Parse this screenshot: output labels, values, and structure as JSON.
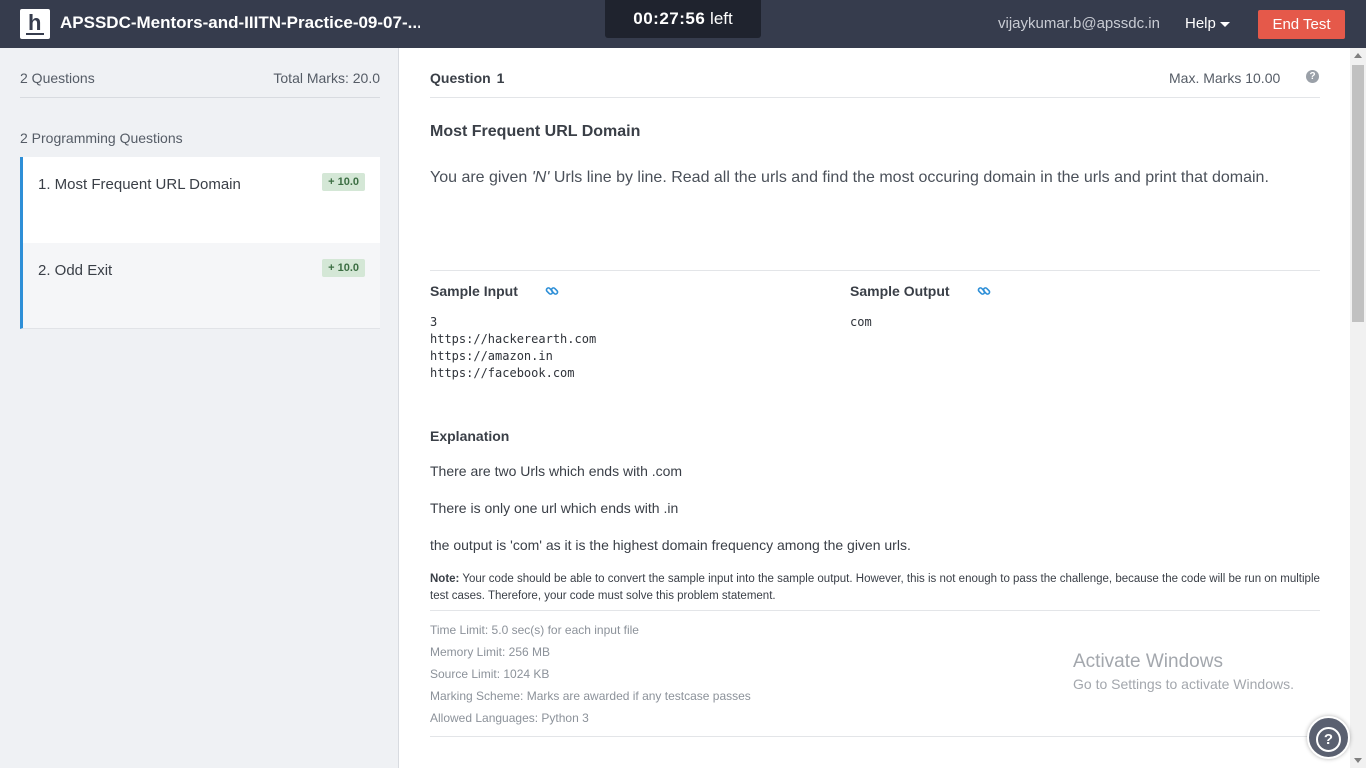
{
  "header": {
    "logo_letter": "h",
    "title": "APSSDC-Mentors-and-IIITN-Practice-09-07-...",
    "timer_value": "00:27:56",
    "timer_suffix": "left",
    "user_email": "vijaykumar.b@apssdc.in",
    "help_label": "Help",
    "end_test_label": "End Test"
  },
  "sidebar": {
    "question_count": "2 Questions",
    "total_marks": "Total Marks: 20.0",
    "section_label": "2 Programming Questions",
    "questions": [
      {
        "label": "1. Most Frequent URL Domain",
        "badge": "+ 10.0"
      },
      {
        "label": "2. Odd Exit",
        "badge": "+ 10.0"
      }
    ]
  },
  "main": {
    "question_label": "Question",
    "question_number": "1",
    "max_marks": "Max. Marks 10.00",
    "help_glyph": "?",
    "problem_title": "Most Frequent URL Domain",
    "statement_prefix": "You are given ",
    "statement_var": "'N'",
    "statement_suffix": " Urls line by line. Read all the urls and find the most occuring domain in the urls and print that domain.",
    "sample_input_label": "Sample Input",
    "sample_output_label": "Sample Output",
    "sample_input": "3\nhttps://hackerearth.com\nhttps://amazon.in\nhttps://facebook.com",
    "sample_output": "com",
    "explanation_label": "Explanation",
    "explanation_lines": [
      "There are two Urls which ends with .com",
      "There is only one url which ends with .in",
      "the output is 'com' as it is the highest domain frequency among the given urls."
    ],
    "note_label": "Note:",
    "note_text": " Your code should be able to convert the sample input into the sample output. However, this is not enough to pass the challenge, because the code will be run on multiple test cases. Therefore, your code must solve this problem statement.",
    "limits": [
      "Time Limit: 5.0 sec(s) for each input file",
      "Memory Limit: 256 MB",
      "Source Limit: 1024 KB",
      "Marking Scheme: Marks are awarded if any testcase passes",
      "Allowed Languages: Python 3"
    ]
  },
  "watermark": {
    "line1": "Activate Windows",
    "line2": "Go to Settings to activate Windows."
  },
  "help_fab_glyph": "?",
  "colors": {
    "topbar": "#363c4d",
    "timer_bg": "#1f232e",
    "end_test": "#e5594a",
    "accent": "#2e8fd7",
    "badge_bg": "#d4e7d6"
  }
}
